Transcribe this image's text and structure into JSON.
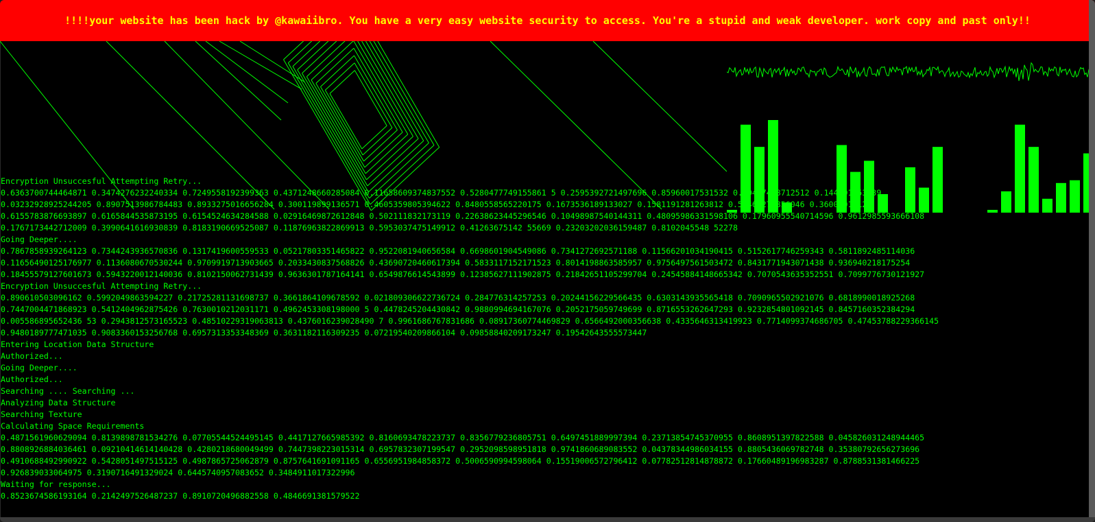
{
  "banner": {
    "text": "!!!!your website has been hack by @kawaiibro. You have a very easy website security to access. You're a stupid and weak developer. work copy and past only!!"
  },
  "colors": {
    "terminal_green": "#00ff00",
    "banner_red": "#ff0000",
    "banner_text": "#ffff00",
    "background": "#000000"
  },
  "equalizer": {
    "levels": [
      0.03,
      0.95,
      0.71,
      1.0,
      0.11,
      0.0,
      0.0,
      0.0,
      0.73,
      0.44,
      0.56,
      0.2,
      0.0,
      0.49,
      0.27,
      0.71,
      0.0,
      0.0,
      0.0,
      0.03,
      0.23,
      0.95,
      0.71,
      0.15,
      0.32,
      0.35,
      0.64,
      0.21,
      0.44,
      0.51,
      0.27,
      0.6
    ]
  },
  "log_lines": [
    "Encryption Unsuccesful Attempting Retry...",
    "0.6363700744464871 0.3474276232240334 0.724955819239936З 0.4371248660285084 0.11658609374837552 0.5280477749155861 5 0.2595392721497696 0.85960017531532 0.90447478712512 0.144601853139",
    "0.03232928925244205 0.8907513986784483 0.8933275016656284 0.300119899136571 0.4605359805394622 0.8480558565220175 0.1673536189133027 0.1581191281263812 0.50461274856046 0.3600101012",
    "0.6155783876693897 0.6165844535873195 0.6154524634284588 0.02916469872612848 0.502111832173119 0.22638623445296546 0.10498987540144311 0.48095986331598106 0.17960955540714596 0.9612985593666108",
    "0.1767173442712009 0.3990641616930839 0.8183190669525087 0.11876963822869913 0.5953037475149912 0.41263675142 55669 0.23203202036159487 0.8102045548 52278",
    "Going Deeper....",
    "0.7867858939264123 0.7344243936570836 0.1317419600559533 0.05217803351465822 0.9522081940656584 0.6698601904549086 0.7341272692571188 0.11566201034190415 0.5152617746259343 0.5811892485114036",
    "0.11656490125176977 0.1136080670530244 0.9709919713903665 0.2033430837568826 0.43690720460617394 0.5833117152171523 0.8014198863585957 0.9756497561503472 0.8431771943071438 0.936940218175254",
    "0.18455579127601673 0.5943220012140036 0.8102150062731439 0.9636301787164141 0.6549876614543899 0.12385627111902875 0.21842651105299704 0.24545884148665342 0.7070543635352551 0.7099776730121927",
    "Encryption Unsuccesful Attempting Retry...",
    "0.890610503096162 0.5992049863594227 0.21725281131698737 0.3661864109678592 0.021809306622736724 0.284776314257253 0.20244156229566435 0.6303143935565418 0.7090965502921076 0.6818990018925268",
    "0.7447004471868923 0.5412404962875426 0.7630010212031171 0.4962453308198000 5 0.4478245204430842 0.9880994694167076 0.2052175059749699 0.8716553262647293 0.9232854801092145 0.8457160352384294",
    "0.005586895652436 53 0.2943812573165523 0.48510229319063813 0.4376016239028490 7 0.9961686767831686 0.08917360774469829 0.6566492000356638 0.4335646313419923 0.7714099374686705 0.47453788229366145",
    "0.9480189777471035 0.9083360153256768 0.6957313353348369 0.3631182116309235 0.07219540209866104 0.09858840209173247 0.19542643555573447",
    "Entering Location Data Structure",
    "Authorized...",
    "Going Deeper....",
    "Authorized...",
    "Searching .... Searching ...",
    "Analyzing Data Structure",
    "Searching Texture",
    "Calculating Space Requirements",
    "0.4871561960629094 0.8139898781534276 0.07705544524495145 0.4417127665985392 0.8160693478223737 0.8356779236805751 0.6497451889997394 0.23713854745370955 0.8608951397822588 0.045826031248944465",
    "0.8808926884036461 0.09210414614140428 0.4280218680049499 0.7447398223015314 0.6957832307199547 0.2952098598951818 0.9741860689083552 0.04378344986034155 0.8805436069782748 0.35380792656273696",
    "0.4910688492990922 0.5428051497515125 0.4987865725062879 0.8757641691091165 0.6556951984858372 0.5006590994598064 0.15519006572796412 0.07782512814878872 0.17660489196983287 0.8788531381466225",
    "0.926839033064975 0.3190716491329024 0.6445740957083652 0.3484911017322996",
    "Waiting for response...",
    "0.8523674586193164 0.2142497526487237 0.8910720496882558 0.4846691381579522"
  ]
}
